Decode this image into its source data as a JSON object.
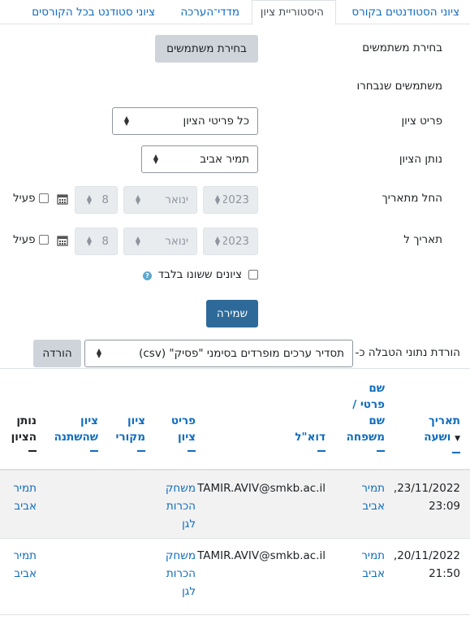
{
  "tabs": [
    {
      "label": "ציוני הסטודנטים בקורס"
    },
    {
      "label": "היסטוריית ציון"
    },
    {
      "label": "מדדי־הערכה"
    },
    {
      "label": "ציוני סטודנט בכל הקורסים"
    }
  ],
  "form": {
    "select_users_label": "בחירת משתמשים",
    "select_users_button": "בחירת משתמשים",
    "selected_users_label": "משתמשים שנבחרו",
    "grade_item_label": "פריט ציון",
    "grade_item_value": "כל פריטי הציון",
    "grader_label": "נותן הציון",
    "grader_value": "תמיר אביב",
    "date_from_label": "החל מתאריך",
    "date_to_label": "תאריך ל",
    "date_from": {
      "year": "2023",
      "month": "ינואר",
      "day": "8",
      "enable_label": "פעיל"
    },
    "date_to": {
      "year": "2023",
      "month": "ינואר",
      "day": "8",
      "enable_label": "פעיל"
    },
    "changed_only_label": "ציונים ששונו בלבד",
    "save_button": "שמירה"
  },
  "download": {
    "label": "הורדת נתוני הטבלה כ-",
    "format_value": "תסדיר ערכים מופרדים בסימני \"פסיק\" (csv)",
    "button": "הורדה"
  },
  "table": {
    "headers": {
      "date_line1": "תאריך",
      "date_line2": "ושעה",
      "name_line1": "שם",
      "name_line2": "פרטי /",
      "name_line3": "שם",
      "name_line4": "משפחה",
      "email": "דוא\"ל",
      "item_line1": "פריט",
      "item_line2": "ציון",
      "orig_line1": "ציון",
      "orig_line2": "מקורי",
      "changed_line1": "ציון",
      "changed_line2": "שהשתנה",
      "grader_line1": "נותן",
      "grader_line2": "הציון"
    },
    "rows": [
      {
        "date_line1": "23/11/2022,",
        "date_line2": "23:09",
        "name_line1": "תמיר",
        "name_line2": "אביב",
        "email": "TAMIR.AVIV@smkb.ac.il",
        "item_line1": "משחק",
        "item_line2": "הכרות",
        "item_line3": "לגן",
        "grader_line1": "תמיר",
        "grader_line2": "אביב"
      },
      {
        "date_line1": "20/11/2022,",
        "date_line2": "21:50",
        "name_line1": "תמיר",
        "name_line2": "אביב",
        "email": "TAMIR.AVIV@smkb.ac.il",
        "item_line1": "משחק",
        "item_line2": "הכרות",
        "item_line3": "לגן",
        "grader_line1": "תמיר",
        "grader_line2": "אביב"
      }
    ]
  },
  "colors": {
    "link": "#0f6cbf",
    "primary_button": "#2e6a99",
    "secondary_button": "#ced4da",
    "row_stripe": "#f2f2f2"
  }
}
